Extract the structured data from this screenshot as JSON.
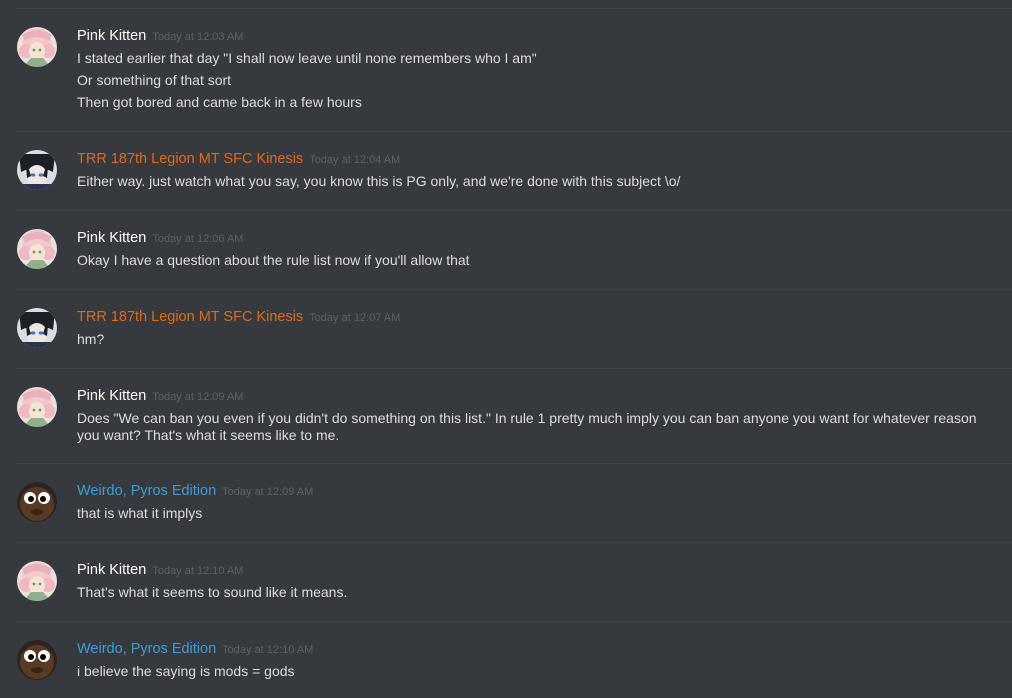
{
  "messages": [
    {
      "author": "Pink Kitten",
      "timestamp": "Today at 12:03 AM",
      "lines": [
        "I stated earlier that day \"I shall now leave until none remembers who I am\"",
        "Or something of that sort",
        "Then got bored and came back in a few hours"
      ]
    },
    {
      "author": "TRR 187th Legion MT SFC Kinesis",
      "timestamp": "Today at 12:04 AM",
      "lines": [
        "Either way. just watch what you say, you know this is PG only, and we're done with this subject \\o/"
      ]
    },
    {
      "author": "Pink Kitten",
      "timestamp": "Today at 12:06 AM",
      "lines": [
        "Okay I have a question about the rule list now if you'll allow that"
      ]
    },
    {
      "author": "TRR 187th Legion MT SFC Kinesis",
      "timestamp": "Today at 12:07 AM",
      "lines": [
        "hm?"
      ]
    },
    {
      "author": "Pink Kitten",
      "timestamp": "Today at 12:09 AM",
      "lines": [
        "Does \"We can ban you even if you didn't do something on this list.\" In rule 1 pretty much imply you can ban anyone you want for whatever reason",
        "you want? That's what it seems like to me."
      ]
    },
    {
      "author": "Weirdo, Pyros Edition",
      "timestamp": "Today at 12:09 AM",
      "lines": [
        "that is what it implys"
      ]
    },
    {
      "author": "Pink Kitten",
      "timestamp": "Today at 12:10 AM",
      "lines": [
        "That's what it seems to sound like it means."
      ]
    },
    {
      "author": "Weirdo, Pyros Edition",
      "timestamp": "Today at 12:10 AM",
      "lines": [
        "i believe the saying is mods = gods"
      ]
    }
  ],
  "colors": {
    "background": "#36393e",
    "divider": "#3f4247",
    "text": "#dcddde",
    "timestamp": "#5d6066",
    "role_default": "#ffffff",
    "role_orange": "#e0681d",
    "role_blue": "#3d9bd9"
  }
}
